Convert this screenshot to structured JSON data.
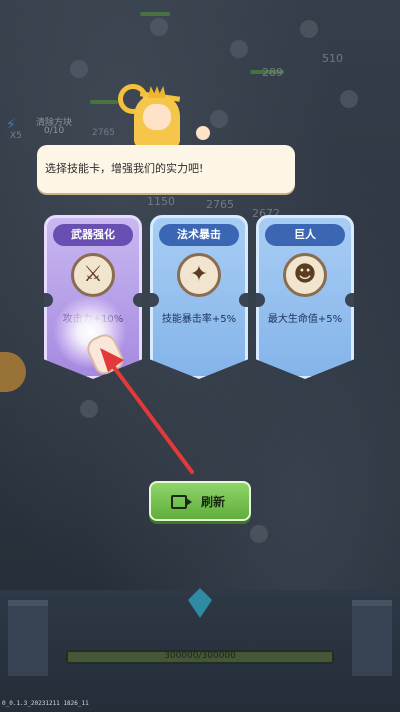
{
  "hud": {
    "buff_title": "清除方块",
    "buff_progress": "0/10",
    "buff_multiplier": "X5",
    "floating_numbers": [
      "289",
      "2765",
      "1150",
      "2672",
      "2765",
      "510"
    ]
  },
  "dialog": {
    "text": "选择技能卡，增强我们的实力吧!"
  },
  "cards": [
    {
      "title": "武器强化",
      "icon": "weapon-slash-icon",
      "description": "攻击力+10%",
      "color": "#a58ae0"
    },
    {
      "title": "法术暴击",
      "icon": "spell-crit-icon",
      "description": "技能暴击率+5%",
      "color": "#84b4ea"
    },
    {
      "title": "巨人",
      "icon": "giant-icon",
      "description": "最大生命值+5%",
      "color": "#84b4ea"
    }
  ],
  "refresh_button": {
    "label": "刷新",
    "icon": "video-ad-icon"
  },
  "base": {
    "hp_text": "300000/300000",
    "hp_fraction": 1.0
  },
  "version": "0_0.1.3_20231211 1826_11",
  "colors": {
    "accent_green": "#5fae3c",
    "arrow_red": "#e23a3a"
  }
}
